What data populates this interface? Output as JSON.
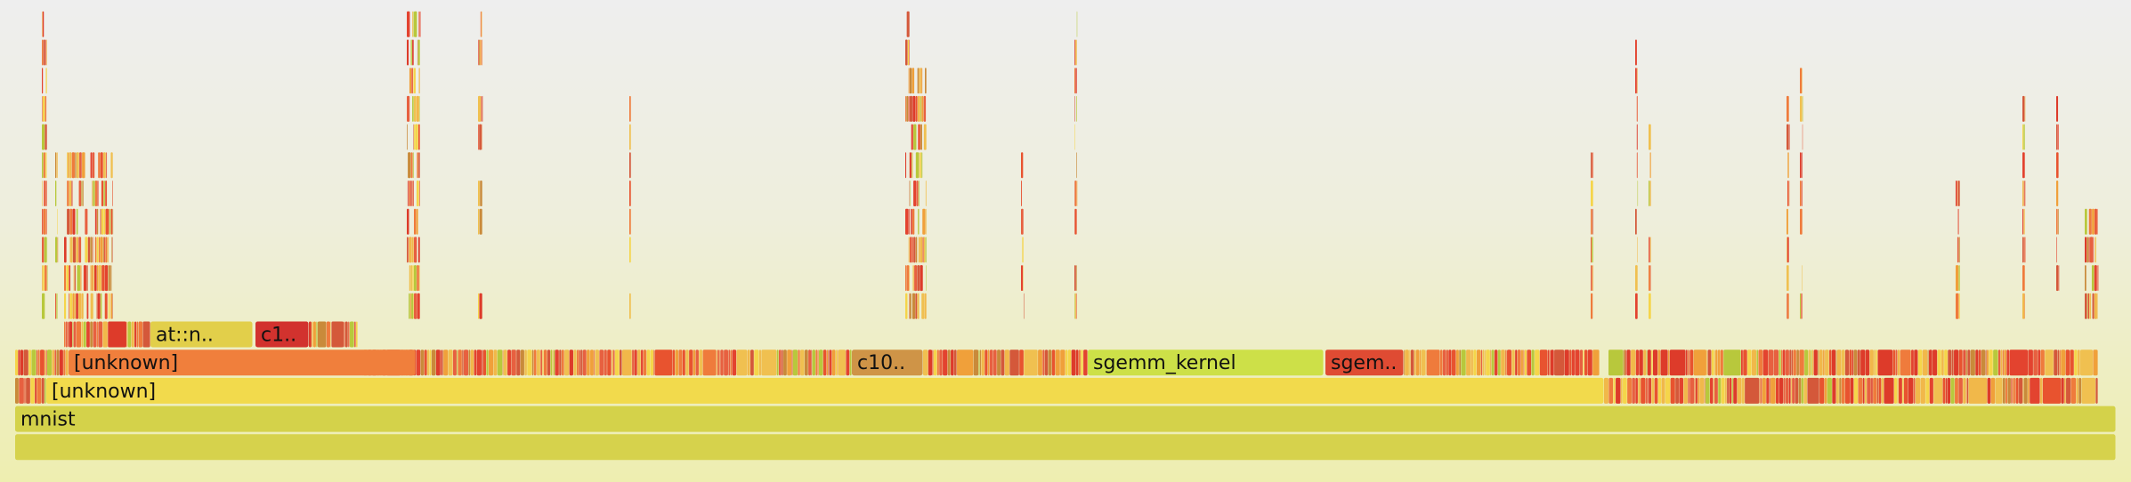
{
  "chart_data": {
    "type": "flamegraph",
    "total_width_units": 2360,
    "palette": [
      "#e8532f",
      "#ef7b3c",
      "#f0a03a",
      "#e3432f",
      "#d4583a",
      "#f1b84a",
      "#f5d54a",
      "#c98a3a",
      "#e76040",
      "#dd3b2a",
      "#f0c050",
      "#b8c83c"
    ],
    "highlight_colors": {
      "root": "#d6d24c",
      "mnist": "#d4d24a",
      "unknown_yellow": "#f2da4c",
      "unknown_orange": "#f07f3c",
      "sgemm_kernel": "#cde048",
      "sgemm_red": "#df4b33",
      "c10_brown": "#cf9447",
      "atn_yellow": "#e2cf4a",
      "c1_red": "#d2322e"
    },
    "frames": [
      {
        "depth": 0,
        "start": 0,
        "width": 2360,
        "label": "",
        "color": "root"
      },
      {
        "depth": 1,
        "start": 0,
        "width": 2360,
        "label": "mnist",
        "color": "mnist"
      },
      {
        "depth": 2,
        "start": 35,
        "width": 1750,
        "label": "[unknown]",
        "color": "unknown_yellow"
      },
      {
        "depth": 3,
        "start": 60,
        "width": 390,
        "label": "[unknown]",
        "color": "unknown_orange"
      },
      {
        "depth": 3,
        "start": 940,
        "width": 80,
        "label": "c10..",
        "color": "c10_brown"
      },
      {
        "depth": 3,
        "start": 1205,
        "width": 265,
        "label": "sgemm_kernel",
        "color": "sgemm_kernel"
      },
      {
        "depth": 3,
        "start": 1472,
        "width": 88,
        "label": "sgem..",
        "color": "sgemm_red"
      },
      {
        "depth": 4,
        "start": 152,
        "width": 115,
        "label": "at::n..",
        "color": "atn_yellow"
      },
      {
        "depth": 4,
        "start": 270,
        "width": 60,
        "label": "c1..",
        "color": "c1_red"
      }
    ],
    "dense_segments": [
      {
        "depth": 2,
        "start": 0,
        "end": 35
      },
      {
        "depth": 2,
        "start": 1785,
        "end": 2340
      },
      {
        "depth": 3,
        "start": 0,
        "end": 60
      },
      {
        "depth": 3,
        "start": 390,
        "end": 940
      },
      {
        "depth": 3,
        "start": 1020,
        "end": 1205
      },
      {
        "depth": 3,
        "start": 1560,
        "end": 1780
      },
      {
        "depth": 3,
        "start": 1790,
        "end": 2340
      },
      {
        "depth": 4,
        "start": 55,
        "end": 152
      },
      {
        "depth": 4,
        "start": 330,
        "end": 385
      }
    ],
    "towers": [
      {
        "start": 30,
        "end": 36,
        "depth": 15
      },
      {
        "start": 45,
        "end": 48,
        "depth": 6
      },
      {
        "start": 55,
        "end": 110,
        "depth": 6
      },
      {
        "start": 440,
        "end": 448,
        "depth": 13
      },
      {
        "start": 448,
        "end": 455,
        "depth": 17
      },
      {
        "start": 520,
        "end": 525,
        "depth": 12
      },
      {
        "start": 690,
        "end": 692,
        "depth": 9
      },
      {
        "start": 1000,
        "end": 1005,
        "depth": 11
      },
      {
        "start": 1005,
        "end": 1024,
        "depth": 9
      },
      {
        "start": 1190,
        "end": 1193,
        "depth": 14
      },
      {
        "start": 1130,
        "end": 1133,
        "depth": 6
      },
      {
        "start": 1770,
        "end": 1773,
        "depth": 6
      },
      {
        "start": 1820,
        "end": 1823,
        "depth": 10
      },
      {
        "start": 1835,
        "end": 1838,
        "depth": 8
      },
      {
        "start": 1990,
        "end": 1993,
        "depth": 8
      },
      {
        "start": 2005,
        "end": 2008,
        "depth": 9
      },
      {
        "start": 2180,
        "end": 2185,
        "depth": 5
      },
      {
        "start": 2255,
        "end": 2258,
        "depth": 8
      },
      {
        "start": 2293,
        "end": 2296,
        "depth": 9
      },
      {
        "start": 2325,
        "end": 2340,
        "depth": 4
      }
    ]
  }
}
